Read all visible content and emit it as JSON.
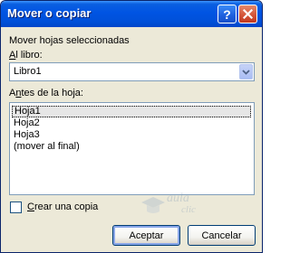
{
  "window": {
    "title": "Mover o copiar",
    "help_glyph": "?",
    "close_icon": "close-icon"
  },
  "dialog": {
    "heading": "Mover hojas seleccionadas",
    "to_book": {
      "label_access_key": "A",
      "label_rest": "l libro:",
      "value": "Libro1"
    },
    "before_sheet": {
      "label_first": "A",
      "label_access_key": "n",
      "label_rest": "tes de la hoja:",
      "items": [
        "Hoja1",
        "Hoja2",
        "Hoja3",
        "(mover al final)"
      ],
      "selected_index": 0
    },
    "create_copy": {
      "label_access_key": "C",
      "label_rest": "rear una copia",
      "checked": false
    },
    "ok_label": "Aceptar",
    "cancel_label": "Cancelar"
  },
  "watermark": {
    "text": "aula",
    "sub_text": "clic"
  },
  "colors": {
    "titlebar": "#0054e3",
    "dialog_bg": "#ece9d8",
    "field_border": "#7f9db9",
    "close_button": "#d5563a"
  }
}
